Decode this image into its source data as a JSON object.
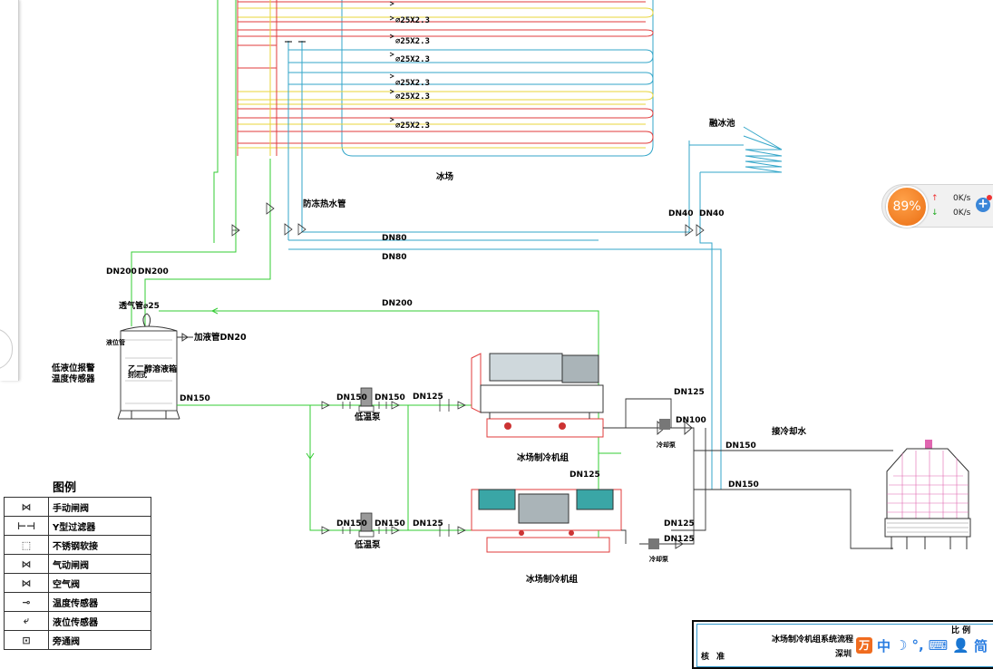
{
  "pipe_specs": [
    "⌀25X2.3",
    "⌀25X2.3",
    "⌀25X2.3",
    "⌀25X2.3",
    "⌀25X2.3",
    "⌀25X2.3"
  ],
  "labels": {
    "ice_rink": "冰场",
    "melt_pit": "融冰池",
    "antifreeze_pipe": "防冻热水管",
    "vent_pipe": "透气管⌀25",
    "add_liquid_pipe": "加液管DN20",
    "level_gauge": "液位管",
    "low_level_alarm": "低液位报警",
    "temp_sensor": "温度传感器",
    "tank_line1": "乙二醇溶液箱",
    "tank_line2": "封闭式",
    "low_temp_pump_1": "低温泵",
    "low_temp_pump_2": "低温泵",
    "chiller_1": "冰场制冷机组",
    "chiller_2": "冰场制冷机组",
    "cooling_pump_1": "冷却泵",
    "cooling_pump_2": "冷却泵",
    "to_cooling_water": "接冷却水"
  },
  "dn": {
    "dn200_a": "DN200",
    "dn200_b": "DN200",
    "dn200_c": "DN200",
    "dn80_a": "DN80",
    "dn80_b": "DN80",
    "dn40_a": "DN40",
    "dn40_b": "DN40",
    "dn150_tank": "DN150",
    "dn150_p1a": "DN150",
    "dn150_p1b": "DN150",
    "dn150_p2a": "DN150",
    "dn150_p2b": "DN150",
    "dn125_p1": "DN125",
    "dn125_p2": "DN125",
    "dn125_c1": "DN125",
    "dn125_mid": "DN125",
    "dn125_c2a": "DN125",
    "dn125_c2b": "DN125",
    "dn100": "DN100",
    "dn150_r1": "DN150",
    "dn150_r2": "DN150"
  },
  "legend": {
    "title": "图例",
    "items": [
      {
        "symbol": "⋈",
        "label": "手动闸阀"
      },
      {
        "symbol": "⊢⊣",
        "label": "Y型过滤器"
      },
      {
        "symbol": "⬚",
        "label": "不锈钢软接"
      },
      {
        "symbol": "⋈",
        "label": "气动闸阀"
      },
      {
        "symbol": "⋈",
        "label": "空气阀"
      },
      {
        "symbol": "⊸",
        "label": "温度传感器"
      },
      {
        "symbol": "⤶",
        "label": "液位传感器"
      },
      {
        "symbol": "⊡",
        "label": "旁通阀"
      }
    ]
  },
  "title_block": {
    "title": "冰场制冷机组系统流程图",
    "scale_label": "比 例",
    "check_label": "核准",
    "company": "深圳"
  },
  "net_widget": {
    "percent": "89%",
    "up": "0K/s",
    "down": "0K/s"
  },
  "ime": {
    "items": [
      "中",
      "☽",
      "°,",
      "⌨",
      "👤",
      "简"
    ]
  },
  "colors": {
    "green": "#33cc33",
    "red": "#e23b3b",
    "yellow": "#e8d53a",
    "cyan": "#33a6c9",
    "blue": "#2a5cd6",
    "accent_orange": "#f07a1e"
  }
}
